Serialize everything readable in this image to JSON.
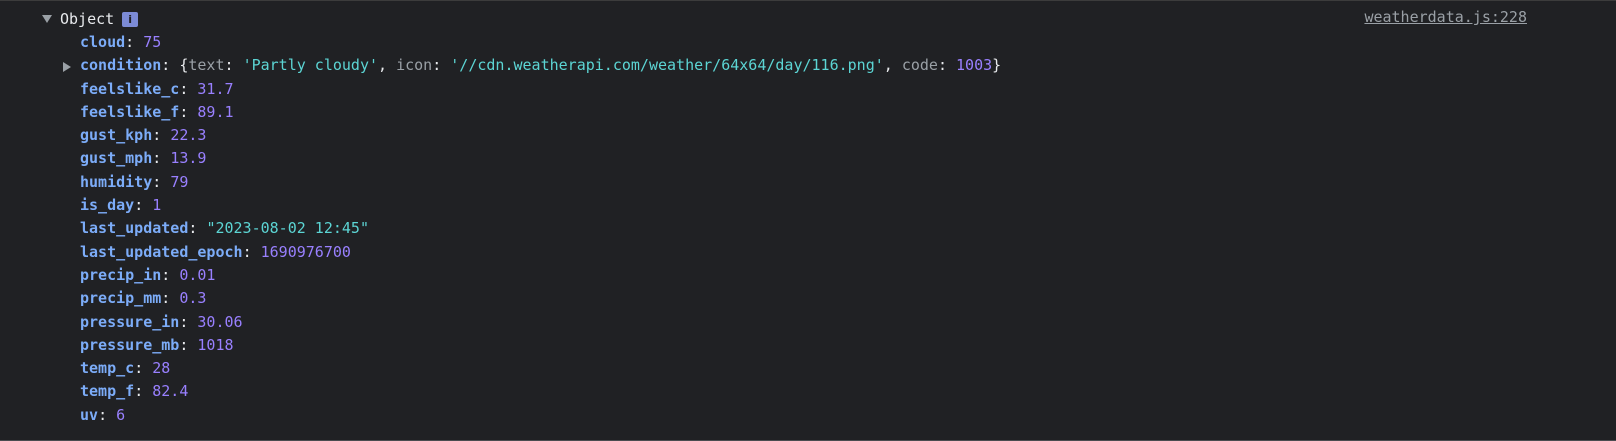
{
  "header": {
    "object_label": "Object",
    "info_badge": "i",
    "source": "weatherdata.js:228"
  },
  "condition": {
    "key": "condition",
    "text_key": "text",
    "text_val": "'Partly cloudy'",
    "icon_key": "icon",
    "icon_val": "'//cdn.weatherapi.com/weather/64x64/day/116.png'",
    "code_key": "code",
    "code_val": "1003"
  },
  "props": [
    {
      "key": "cloud",
      "value": "75",
      "type": "num"
    },
    {
      "key": "feelslike_c",
      "value": "31.7",
      "type": "num"
    },
    {
      "key": "feelslike_f",
      "value": "89.1",
      "type": "num"
    },
    {
      "key": "gust_kph",
      "value": "22.3",
      "type": "num"
    },
    {
      "key": "gust_mph",
      "value": "13.9",
      "type": "num"
    },
    {
      "key": "humidity",
      "value": "79",
      "type": "num"
    },
    {
      "key": "is_day",
      "value": "1",
      "type": "num"
    },
    {
      "key": "last_updated",
      "value": "\"2023-08-02 12:45\"",
      "type": "str"
    },
    {
      "key": "last_updated_epoch",
      "value": "1690976700",
      "type": "num"
    },
    {
      "key": "precip_in",
      "value": "0.01",
      "type": "num"
    },
    {
      "key": "precip_mm",
      "value": "0.3",
      "type": "num"
    },
    {
      "key": "pressure_in",
      "value": "30.06",
      "type": "num"
    },
    {
      "key": "pressure_mb",
      "value": "1018",
      "type": "num"
    },
    {
      "key": "temp_c",
      "value": "28",
      "type": "num"
    },
    {
      "key": "temp_f",
      "value": "82.4",
      "type": "num"
    },
    {
      "key": "uv",
      "value": "6",
      "type": "num"
    }
  ]
}
